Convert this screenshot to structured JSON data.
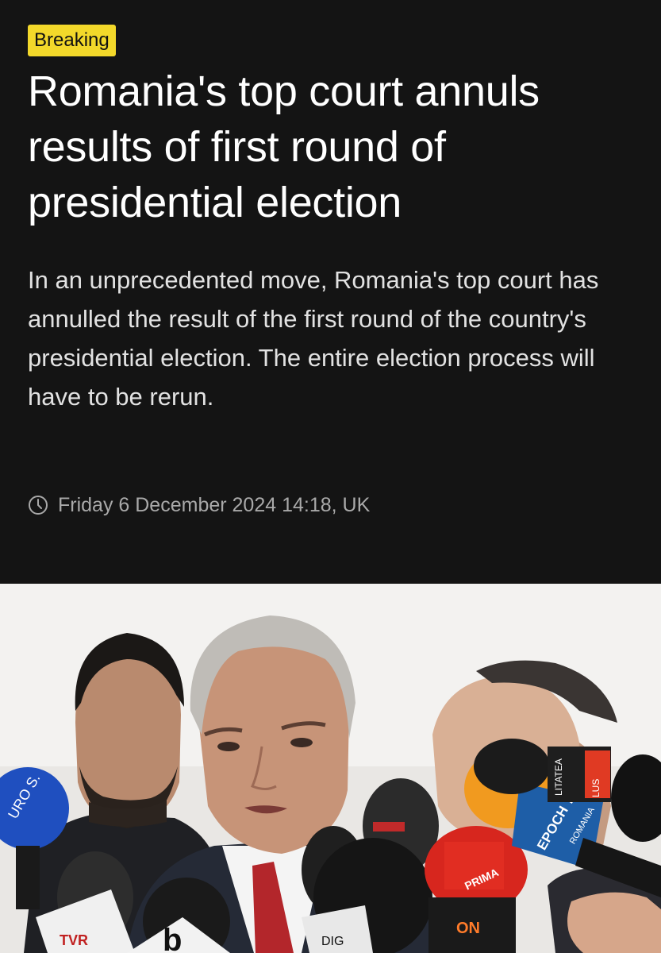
{
  "article": {
    "badge": "Breaking",
    "headline": "Romania's top court annuls results of first round of presidential election",
    "standfirst": "In an unprecedented move, Romania's top court has annulled the result of the first round of the country's presidential election. The entire election process will have to be rerun.",
    "timestamp": "Friday 6 December 2024 14:18, UK",
    "timestamp_icon": "clock-icon"
  },
  "hero_image": {
    "mic_labels": {
      "epoch": "EPOCH TIMES",
      "epoch_sub": "ROMANIA",
      "realitatea": "LITATEA",
      "realitatea_sub": "LUS",
      "prima": "PRIMA",
      "b1": "b",
      "eurons": "URO S.",
      "tvr": "TVR",
      "antena": "ON",
      "digi": "DIG"
    }
  },
  "colors": {
    "header_background": "#141414",
    "badge_background": "#f3d82a",
    "headline_text": "#ffffff",
    "standfirst_text": "#e2e2e2",
    "timestamp_text": "#a9a9a9"
  }
}
